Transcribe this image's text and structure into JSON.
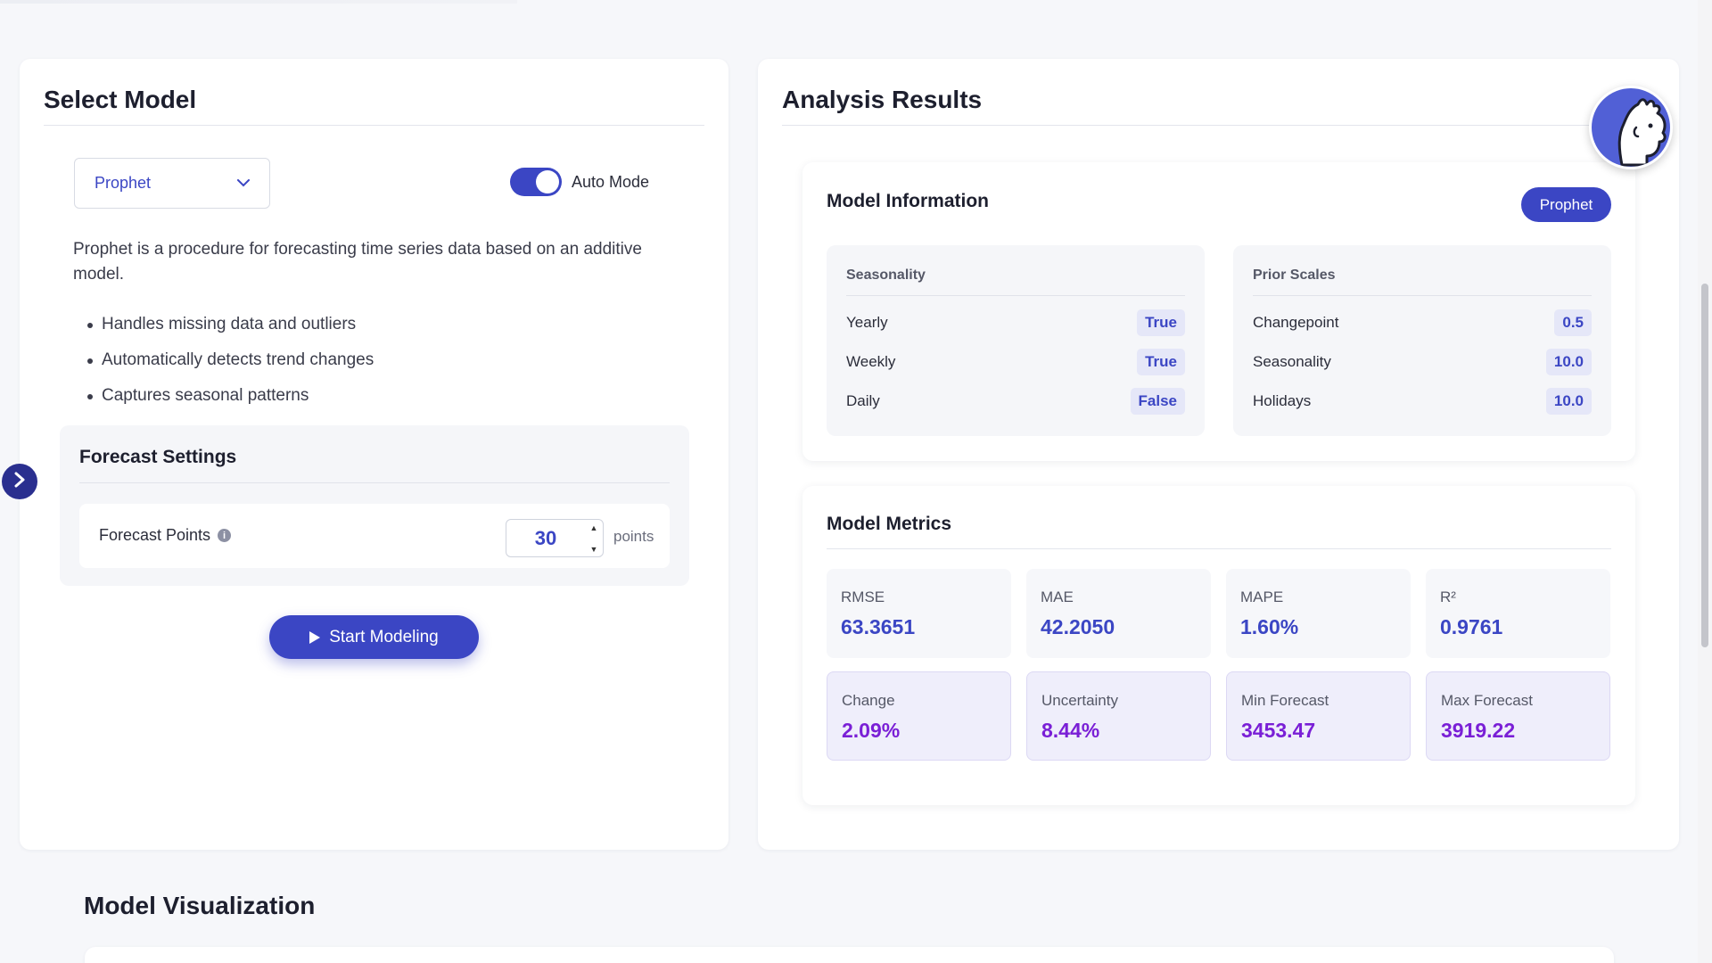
{
  "left": {
    "title": "Select Model",
    "model_select": {
      "value": "Prophet"
    },
    "auto_mode": {
      "label": "Auto Mode",
      "on": true
    },
    "description": "Prophet is a procedure for forecasting time series data based on an additive model.",
    "features": [
      "Handles missing data and outliers",
      "Automatically detects trend changes",
      "Captures seasonal patterns"
    ],
    "forecast_settings": {
      "title": "Forecast Settings",
      "points_label": "Forecast Points",
      "points_value": "30",
      "unit": "points"
    },
    "start_button": "Start Modeling"
  },
  "right": {
    "title": "Analysis Results",
    "model_info": {
      "title": "Model Information",
      "badge": "Prophet",
      "seasonality": {
        "heading": "Seasonality",
        "rows": [
          {
            "key": "Yearly",
            "value": "True"
          },
          {
            "key": "Weekly",
            "value": "True"
          },
          {
            "key": "Daily",
            "value": "False"
          }
        ]
      },
      "prior_scales": {
        "heading": "Prior Scales",
        "rows": [
          {
            "key": "Changepoint",
            "value": "0.5"
          },
          {
            "key": "Seasonality",
            "value": "10.0"
          },
          {
            "key": "Holidays",
            "value": "10.0"
          }
        ]
      }
    },
    "model_metrics": {
      "title": "Model Metrics",
      "metrics": [
        {
          "label": "RMSE",
          "value": "63.3651"
        },
        {
          "label": "MAE",
          "value": "42.2050"
        },
        {
          "label": "MAPE",
          "value": "1.60%"
        },
        {
          "label": "R²",
          "value": "0.9761"
        },
        {
          "label": "Change",
          "value": "2.09%"
        },
        {
          "label": "Uncertainty",
          "value": "8.44%"
        },
        {
          "label": "Min Forecast",
          "value": "3453.47"
        },
        {
          "label": "Max Forecast",
          "value": "3919.22"
        }
      ]
    }
  },
  "visualization": {
    "title": "Model Visualization"
  },
  "colors": {
    "accent": "#3b46c4",
    "purple": "#7a1fd6",
    "background": "#f6f7fa"
  },
  "icons": [
    "chevron-down-icon",
    "info-icon",
    "play-icon",
    "chevron-right-icon",
    "avatar-icon"
  ]
}
